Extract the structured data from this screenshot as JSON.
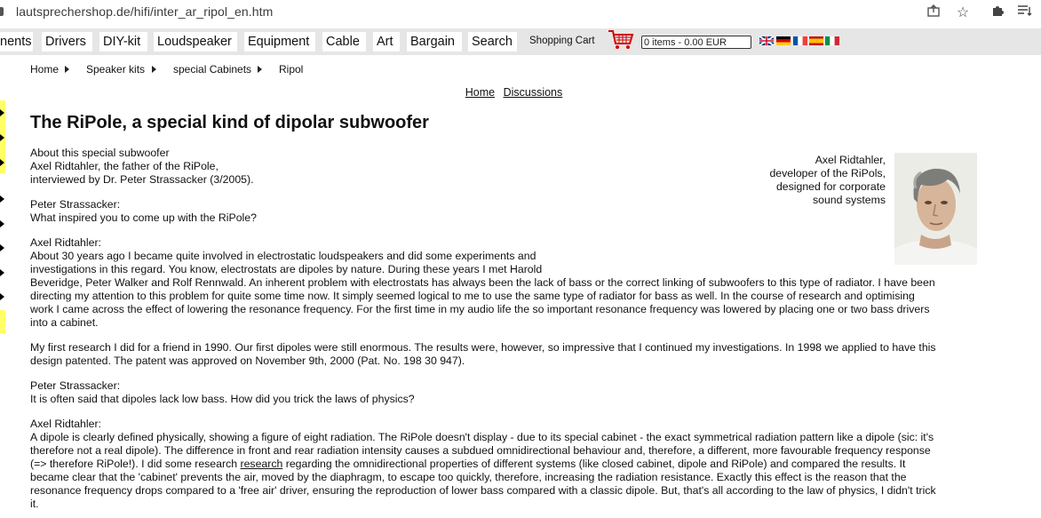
{
  "browser": {
    "url": "lautsprechershop.de/hifi/inter_ar_ripol_en.htm"
  },
  "nav": {
    "items": [
      "nents",
      "Drivers",
      "DIY-kit",
      "Loudspeaker",
      "Equipment",
      "Cable",
      "Art",
      "Bargain",
      "Search"
    ],
    "cart_label": "Shopping Cart",
    "cart_value": "0 items - 0.00 EUR"
  },
  "breadcrumb": [
    "Home",
    "Speaker kits",
    "special Cabinets",
    "Ripol"
  ],
  "top_links": [
    "Home",
    "Discussions"
  ],
  "title": "The RiPole, a special kind of dipolar subwoofer",
  "intro": [
    "About this special subwoofer",
    "Axel Ridtahler, the father of the RiPole,",
    "interviewed by Dr. Peter Strassacker (3/2005)."
  ],
  "caption": [
    "Axel Ridtahler,",
    "developer of the RiPols,",
    "designed for corporate",
    "sound systems"
  ],
  "q1": [
    "Peter Strassacker:",
    "What inspired you to come up with the RiPole?"
  ],
  "a1": [
    "Axel Ridtahler:",
    "About 30 years ago I became quite involved in electrostatic loudspeakers and did some experiments and",
    "investigations in this regard. You know, electrostats are dipoles by nature. During these years I met Harold",
    "Beveridge, Peter Walker and Rolf Rennwald. An inherent problem with electrostats has always been the lack of bass or the correct linking of subwoofers to this type of radiator. I have been",
    "directing my attention to this problem for quite some time now. It simply seemed logical to me to use the same type of radiator for bass as well. In the course of research and optimising",
    "work I came across the effect of lowering the resonance frequency. For the first time in my audio life the so important resonance frequency was lowered by placing one or two bass drivers",
    "into a cabinet."
  ],
  "a1b": [
    "My first research I did for a friend in 1990. Our first dipoles were still enormous. The results were, however, so impressive that I continued my investigations. In 1998 we applied to have this",
    "design patented. The patent was approved on November 9th, 2000 (Pat. No. 198 30 947)."
  ],
  "q2": [
    "Peter Strassacker:",
    "It is often said that dipoles lack low bass. How did you trick the laws of physics?"
  ],
  "a2_head": "Axel Ridtahler:",
  "a2_l1": "A dipole is clearly defined physically, showing a figure of eight radiation. The RiPole doesn't display - due to its special cabinet - the exact symmetrical radiation pattern like a dipole (sic: it's",
  "a2_l2": "therefore not a real dipole). The difference in front and rear radiation intensity causes a subdued omnidirectional behaviour and, therefore, a different, more favourable frequency response",
  "a2_l3_pre": "(=> therefore RiPole!). I did some research ",
  "a2_l3_link": "research",
  "a2_l3_post": " regarding the omnidirectional properties of different systems (like closed cabinet, dipole and RiPole) and compared the results. It",
  "a2_l4": "became clear that the 'cabinet' prevents the air, moved by the diaphragm, to escape too quickly, therefore, increasing the radiation resistance. Exactly this effect is the reason that the",
  "a2_l5": "resonance frequency drops compared to a 'free air' driver, ensuring the reproduction of lower bass compared with a classic dipole. But, that's all according to the law of physics, I didn't trick",
  "a2_l6": "it.",
  "colors": {
    "nav_bg": "#e6e6e6",
    "cart_red": "#d40000",
    "edge_yellow": "#ffff66"
  }
}
